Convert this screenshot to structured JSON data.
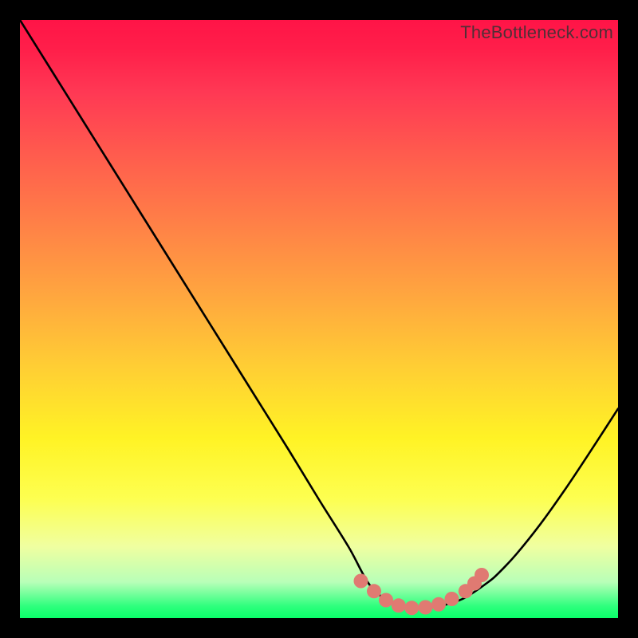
{
  "watermark": "TheBottleneck.com",
  "chart_data": {
    "type": "line",
    "title": "",
    "xlabel": "",
    "ylabel": "",
    "xlim": [
      0,
      1
    ],
    "ylim": [
      0,
      1
    ],
    "series": [
      {
        "name": "curve",
        "x": [
          0.0,
          0.05,
          0.1,
          0.15,
          0.2,
          0.25,
          0.3,
          0.35,
          0.4,
          0.45,
          0.5,
          0.55,
          0.585,
          0.62,
          0.66,
          0.7,
          0.74,
          0.78,
          0.8,
          0.83,
          0.87,
          0.91,
          0.95,
          1.0
        ],
        "values": [
          1.0,
          0.92,
          0.84,
          0.76,
          0.68,
          0.6,
          0.52,
          0.44,
          0.36,
          0.28,
          0.198,
          0.118,
          0.055,
          0.027,
          0.018,
          0.02,
          0.032,
          0.058,
          0.075,
          0.107,
          0.157,
          0.213,
          0.273,
          0.35
        ]
      }
    ],
    "trough_markers": {
      "x": [
        0.57,
        0.592,
        0.612,
        0.633,
        0.655,
        0.678,
        0.7,
        0.722,
        0.745,
        0.76,
        0.772
      ],
      "y": [
        0.062,
        0.045,
        0.03,
        0.021,
        0.017,
        0.018,
        0.023,
        0.032,
        0.045,
        0.058,
        0.072
      ]
    }
  }
}
